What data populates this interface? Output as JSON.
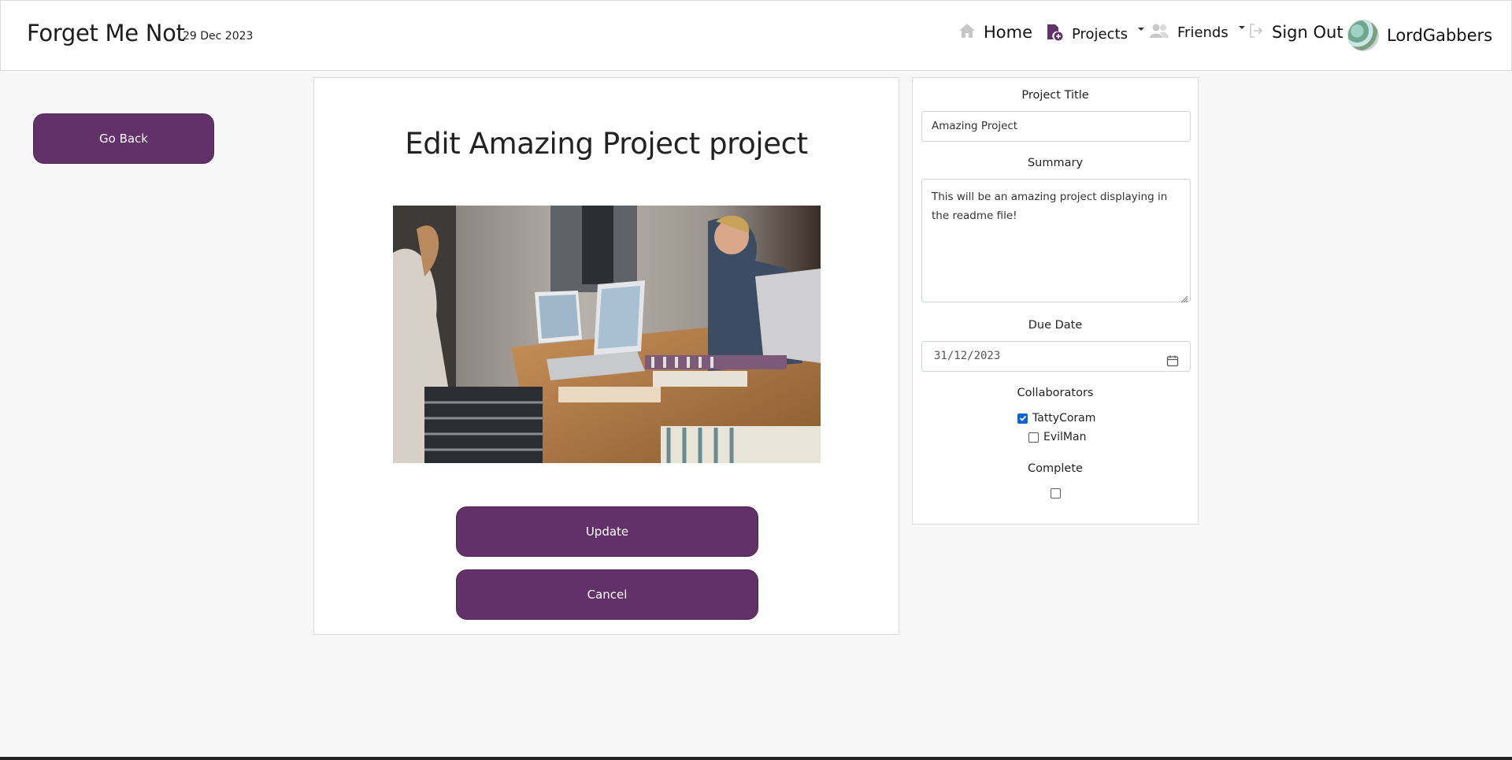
{
  "navbar": {
    "brand": "Forget Me Not",
    "date": "29 Dec 2023",
    "home": "Home",
    "projects": "Projects",
    "friends": "Friends",
    "sign_out": "Sign Out",
    "username": "LordGabbers"
  },
  "left": {
    "go_back": "Go Back"
  },
  "main": {
    "title": "Edit Amazing Project project",
    "update": "Update",
    "cancel": "Cancel"
  },
  "form": {
    "title_label": "Project Title",
    "title_value": "Amazing Project",
    "summary_label": "Summary",
    "summary_value": "This will be an amazing project displaying in the readme file!",
    "due_label": "Due Date",
    "due_value": "31/12/2023",
    "collab_label": "Collaborators",
    "collaborators": [
      {
        "name": "TattyCoram",
        "checked": true
      },
      {
        "name": "EvilMan",
        "checked": false
      }
    ],
    "complete_label": "Complete",
    "complete_checked": false
  },
  "colors": {
    "accent": "#633169",
    "checkbox": "#0b63d4"
  },
  "icons": [
    "home-icon",
    "projects-icon",
    "friends-icon",
    "sign-out-icon",
    "calendar-icon"
  ]
}
